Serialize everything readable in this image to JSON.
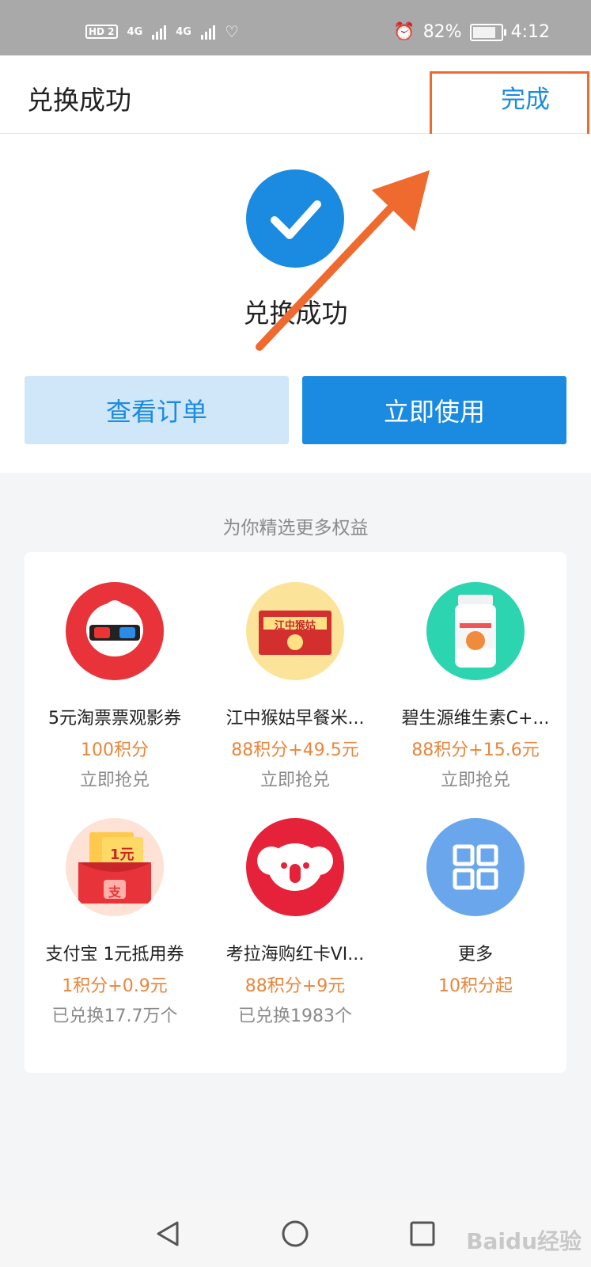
{
  "status": {
    "signal_label": "HD 2",
    "net1": "4G",
    "net2": "4G",
    "battery": "82%",
    "time": "4:12"
  },
  "header": {
    "title": "兑换成功",
    "done_label": "完成"
  },
  "result": {
    "message": "兑换成功",
    "view_order_label": "查看订单",
    "use_now_label": "立即使用"
  },
  "recommend": {
    "title": "为你精选更多权益",
    "items": [
      {
        "name": "5元淘票票观影券",
        "price": "100积分",
        "sub": "立即抢兑",
        "icon": "3d-glasses-mascot-icon"
      },
      {
        "name": "江中猴姑早餐米...",
        "price": "88积分+49.5元",
        "sub": "立即抢兑",
        "icon": "rice-box-icon",
        "box_text": "江中猴姑"
      },
      {
        "name": "碧生源维生素C+...",
        "price": "88积分+15.6元",
        "sub": "立即抢兑",
        "icon": "vitamin-bottle-icon"
      },
      {
        "name": "支付宝 1元抵用券",
        "price": "1积分+0.9元",
        "sub": "已兑换17.7万个",
        "icon": "red-envelope-icon",
        "coupon_text": "1元",
        "envelope_text": "支"
      },
      {
        "name": "考拉海购红卡VI...",
        "price": "88积分+9元",
        "sub": "已兑换1983个",
        "icon": "koala-icon"
      },
      {
        "name": "更多",
        "price": "10积分起",
        "sub": "",
        "icon": "grid-icon"
      }
    ]
  },
  "colors": {
    "accent": "#1a8be0",
    "price": "#e8863c",
    "annotation": "#ee6a2e"
  },
  "watermark": "Baidu经验"
}
